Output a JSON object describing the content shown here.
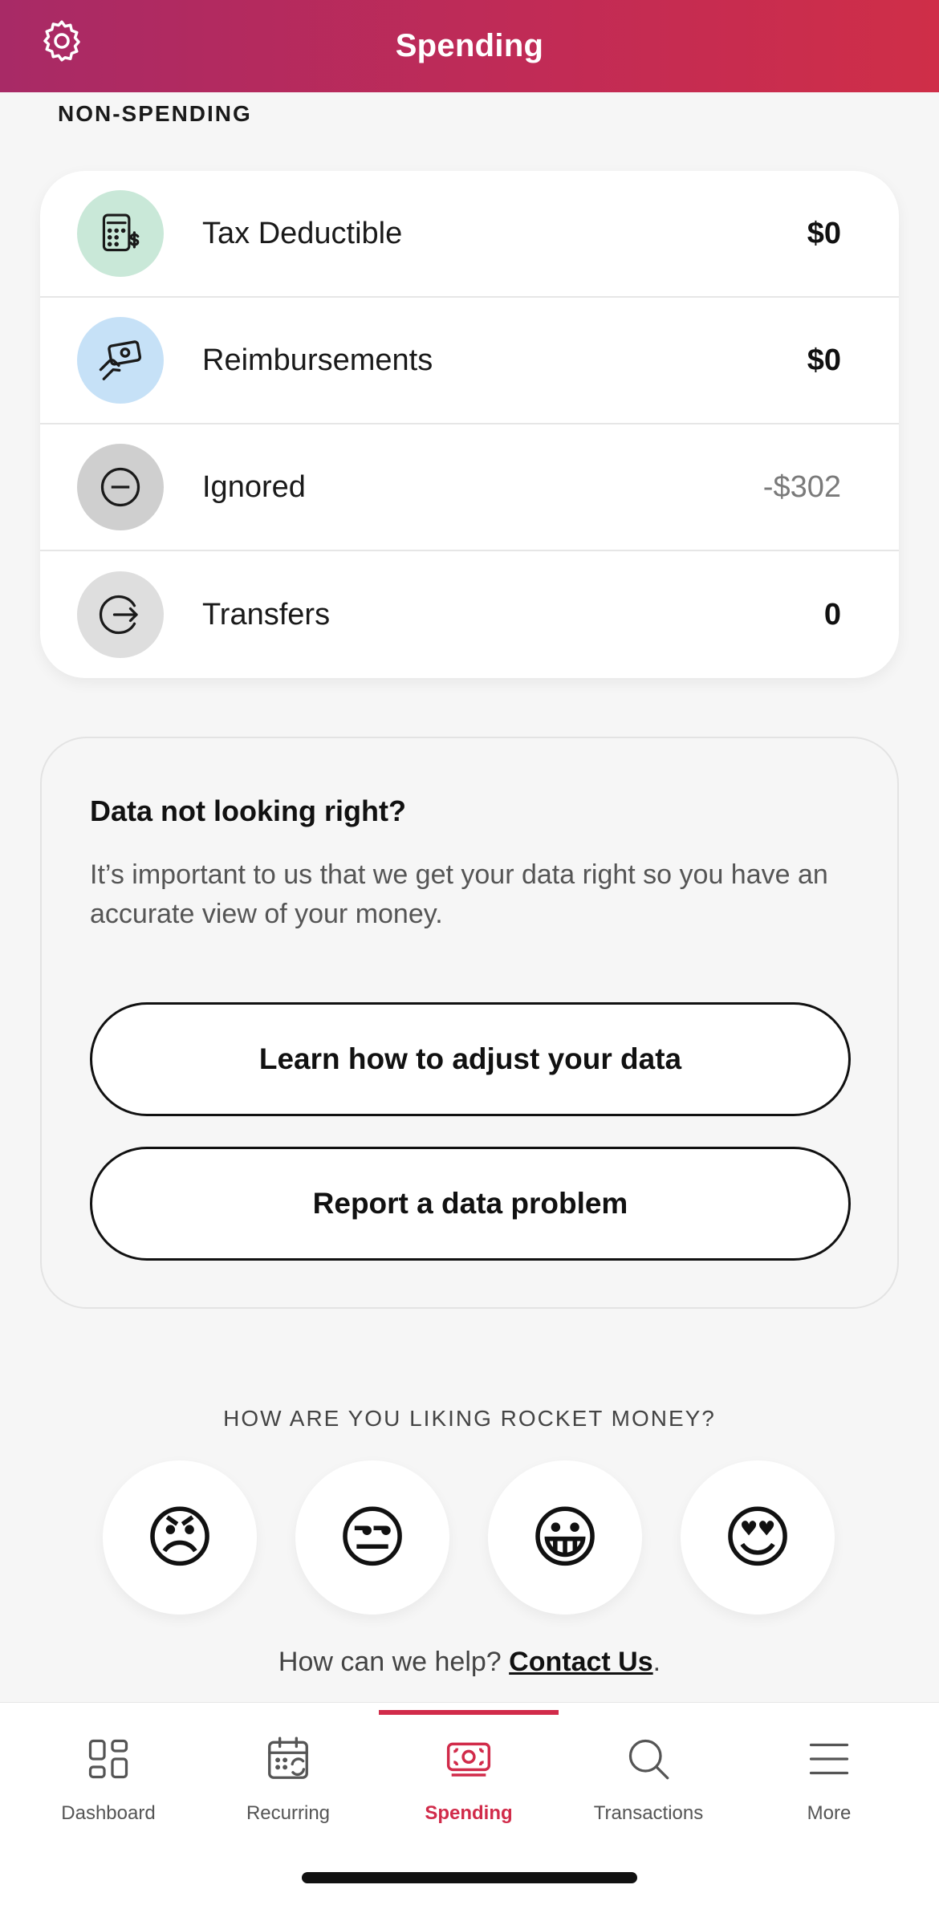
{
  "header": {
    "title": "Spending",
    "settings_icon": "gear-icon"
  },
  "non_spending": {
    "section_label": "NON-SPENDING",
    "rows": [
      {
        "label": "Tax Deductible",
        "value": "$0",
        "icon": "calculator-dollar-icon",
        "icon_bg": "#c9e8d8"
      },
      {
        "label": "Reimbursements",
        "value": "$0",
        "icon": "hand-cash-icon",
        "icon_bg": "#c6e1f7"
      },
      {
        "label": "Ignored",
        "value": "-$302",
        "icon": "minus-circle-icon",
        "icon_bg": "#cfcfcf"
      },
      {
        "label": "Transfers",
        "value": "0",
        "icon": "arrow-right-circle-icon",
        "icon_bg": "#dedede"
      }
    ]
  },
  "help_card": {
    "title": "Data not looking right?",
    "body": "It’s important to us that we get your data right so you have an accurate view of your money.",
    "learn_button": "Learn how to adjust your data",
    "report_button": "Report a data problem"
  },
  "rating": {
    "label": "HOW ARE YOU LIKING ROCKET MONEY?",
    "options": [
      {
        "emoji": "😠",
        "name": "angry-face-icon"
      },
      {
        "emoji": "😒",
        "name": "unamused-face-icon"
      },
      {
        "emoji": "😀",
        "name": "grinning-face-icon"
      },
      {
        "emoji": "😍",
        "name": "heart-eyes-face-icon"
      }
    ]
  },
  "contact": {
    "prefix": "How can we help? ",
    "link": "Contact Us",
    "suffix": "."
  },
  "bottom_nav": {
    "items": [
      {
        "label": "Dashboard",
        "icon": "dashboard-grid-icon"
      },
      {
        "label": "Recurring",
        "icon": "calendar-recurring-icon"
      },
      {
        "label": "Spending",
        "icon": "spending-cash-icon",
        "active": true
      },
      {
        "label": "Transactions",
        "icon": "search-icon"
      },
      {
        "label": "More",
        "icon": "hamburger-menu-icon"
      }
    ],
    "active_color": "#d12b4a"
  },
  "colors": {
    "header_gradient_start": "#a82a66",
    "header_gradient_end": "#cf2e48",
    "accent": "#d12b4a"
  }
}
